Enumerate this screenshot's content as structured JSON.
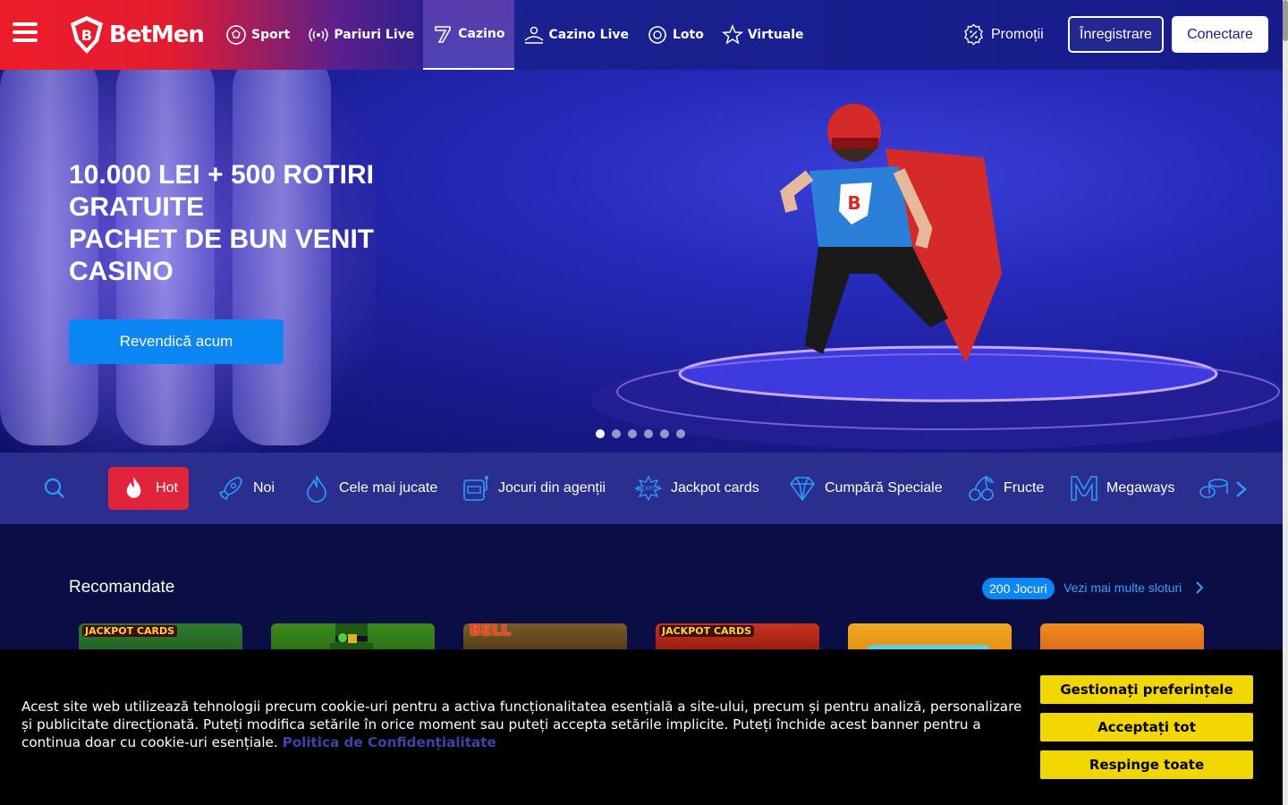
{
  "header": {
    "logo_text": "BetMen",
    "nav": [
      {
        "label": "Sport",
        "icon": "soccer-ball-icon"
      },
      {
        "label": "Pariuri Live",
        "icon": "broadcast-icon"
      },
      {
        "label": "Cazino",
        "icon": "seven-icon",
        "active": true
      },
      {
        "label": "Cazino Live",
        "icon": "dealer-icon"
      },
      {
        "label": "Loto",
        "icon": "lottery-ball-icon"
      },
      {
        "label": "Virtuale",
        "icon": "star-icon"
      }
    ],
    "promo_label": "Promoții",
    "register_label": "Înregistrare",
    "login_label": "Conectare"
  },
  "hero": {
    "title_lines": [
      "10.000 LEI + 500 ROTIRI",
      "GRATUITE",
      "PACHET DE BUN VENIT",
      "CASINO"
    ],
    "cta_label": "Revendică acum",
    "slides_count": 6,
    "active_slide": 1
  },
  "categories": [
    {
      "label": "Hot",
      "icon": "flame-icon",
      "active": true
    },
    {
      "label": "Noi",
      "icon": "rocket-icon"
    },
    {
      "label": "Cele mai jucate",
      "icon": "drop-icon"
    },
    {
      "label": "Jocuri din agenții",
      "icon": "slot-machine-icon"
    },
    {
      "label": "Jackpot cards",
      "icon": "jackpot-icon"
    },
    {
      "label": "Cumpără Speciale",
      "icon": "diamond-icon"
    },
    {
      "label": "Fructe",
      "icon": "cherries-icon"
    },
    {
      "label": "Megaways",
      "icon": "megaways-icon"
    }
  ],
  "recommended": {
    "title": "Recomandate",
    "badge": "200 Jocuri",
    "more_label": "Vezi mai multe sloturi",
    "games": [
      {
        "label": "JACKPOT CARDS",
        "color": "#1f7a2a"
      },
      {
        "label": "",
        "color": "#2a8a1e"
      },
      {
        "label": "BELL",
        "color": "#6a4a1a"
      },
      {
        "label": "JACKPOT CARDS",
        "color": "#b8281a"
      },
      {
        "label": "",
        "color": "#e89a10"
      },
      {
        "label": "",
        "color": "#e8781a"
      }
    ]
  },
  "cookie": {
    "text": "Acest site web utilizează tehnologii precum cookie-uri pentru a activa funcționalitatea esențială a site-ului, precum și pentru analiză, personalizare și publicitate direcționată. Puteți modifica setările în orice moment sau puteți accepta setările implicite. Puteți închide acest banner pentru a continua doar cu cookie-uri esențiale.",
    "link": "Politica de Confidențialitate",
    "manage_label": "Gestionați preferințele",
    "accept_label": "Acceptați tot",
    "reject_label": "Respinge toate"
  },
  "colors": {
    "brand_red": "#ee1c2a",
    "header_blue": "#161c8a",
    "cta_blue": "#0a86f5",
    "cookie_yellow": "#f2d600"
  }
}
